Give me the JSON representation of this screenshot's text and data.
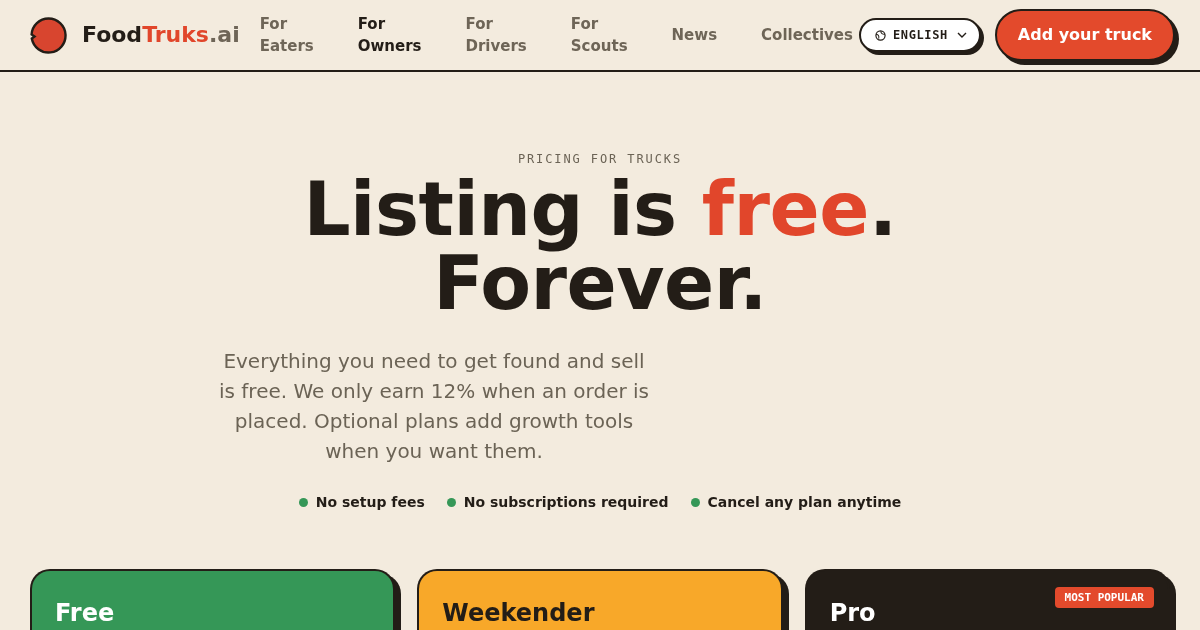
{
  "header": {
    "brand": [
      {
        "text": "Food",
        "kind": "plain"
      },
      {
        "text": "Truks",
        "kind": "accent"
      },
      {
        "text": ".ai",
        "kind": "muted"
      }
    ],
    "nav": [
      {
        "label": "For Eaters",
        "selected": false
      },
      {
        "label": "For Owners",
        "selected": true
      },
      {
        "label": "For Drivers",
        "selected": false
      },
      {
        "label": "For Scouts",
        "selected": false
      },
      {
        "label": "News",
        "selected": false
      },
      {
        "label": "Collectives",
        "selected": false
      }
    ],
    "language_button": {
      "label": "ENGLISH"
    },
    "cta_button": {
      "label": "Add your truck"
    }
  },
  "hero": {
    "eyebrow": "PRICING FOR TRUCKS",
    "title_lines": [
      [
        {
          "text": "Listing is ",
          "kind": "plain"
        },
        {
          "text": "free",
          "kind": "accent"
        },
        {
          "text": ".",
          "kind": "plain"
        }
      ],
      [
        {
          "text": "Forever.",
          "kind": "plain"
        }
      ]
    ],
    "description": "Everything you need to get found and sell is free. We only earn 12% when an order is placed. Optional plans add growth tools when you want them.",
    "features": [
      {
        "text": "No setup fees"
      },
      {
        "text": "No subscriptions required"
      },
      {
        "text": "Cancel any plan anytime"
      }
    ]
  },
  "plans": [
    {
      "name": "Free",
      "color": "#359757"
    },
    {
      "name": "Weekender",
      "color": "#f8a829"
    },
    {
      "name": "Pro",
      "color": "#231d17",
      "badge": "MOST POPULAR"
    }
  ]
}
